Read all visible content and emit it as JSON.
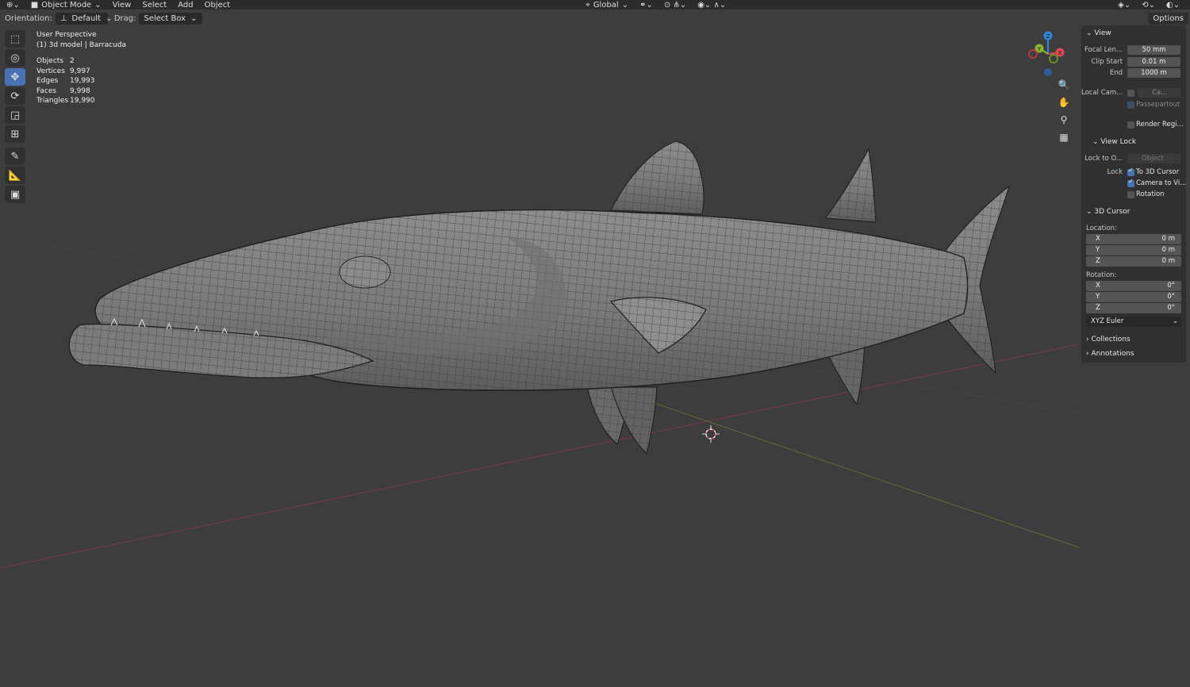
{
  "topbar": {
    "mode": "Object Mode",
    "menus": [
      "View",
      "Select",
      "Add",
      "Object"
    ],
    "transform_orientation": "Global"
  },
  "options_bar": {
    "orientation_label": "Orientation:",
    "orientation_value": "Default",
    "drag_label": "Drag:",
    "drag_value": "Select Box",
    "options_label": "Options"
  },
  "viewport_info": {
    "perspective": "User Perspective",
    "object_name": "(1) 3d model | Barracuda",
    "stats": [
      {
        "label": "Objects",
        "value": "2"
      },
      {
        "label": "Vertices",
        "value": "9,997"
      },
      {
        "label": "Edges",
        "value": "19,993"
      },
      {
        "label": "Faces",
        "value": "9,998"
      },
      {
        "label": "Triangles",
        "value": "19,990"
      }
    ]
  },
  "gizmo": {
    "z_label": "Z",
    "x_label": "X",
    "y_label": "Y"
  },
  "npanel": {
    "view": {
      "title": "View",
      "focal_label": "Focal Len...",
      "focal_value": "50 mm",
      "clip_start_label": "Clip Start",
      "clip_start_value": "0.01 m",
      "end_label": "End",
      "end_value": "1000 m",
      "local_cam_label": "Local Cam...",
      "local_cam_value": "Ca...",
      "passepartout": "Passepartout",
      "render_region": "Render Regi..."
    },
    "view_lock": {
      "title": "View Lock",
      "lock_to_label": "Lock to O...",
      "lock_to_placeholder": "Object",
      "lock_label": "Lock",
      "to_3d_cursor": "To 3D Cursor",
      "camera_to_view": "Camera to Vi...",
      "rotation": "Rotation"
    },
    "cursor": {
      "title": "3D Cursor",
      "location_label": "Location:",
      "location": [
        {
          "axis": "X",
          "value": "0 m"
        },
        {
          "axis": "Y",
          "value": "0 m"
        },
        {
          "axis": "Z",
          "value": "0 m"
        }
      ],
      "rotation_label": "Rotation:",
      "rotation": [
        {
          "axis": "X",
          "value": "0°"
        },
        {
          "axis": "Y",
          "value": "0°"
        },
        {
          "axis": "Z",
          "value": "0°"
        }
      ],
      "rotation_mode": "XYZ Euler"
    },
    "collections": "Collections",
    "annotations": "Annotations"
  },
  "colors": {
    "accent": "#4772b3",
    "viewport_bg": "#3d3d3d",
    "x_axis": "#8b3a45",
    "y_axis": "#6b7d3a",
    "gizmo_x": "#e04a55",
    "gizmo_y": "#8ab32e",
    "gizmo_z": "#2f86de"
  }
}
